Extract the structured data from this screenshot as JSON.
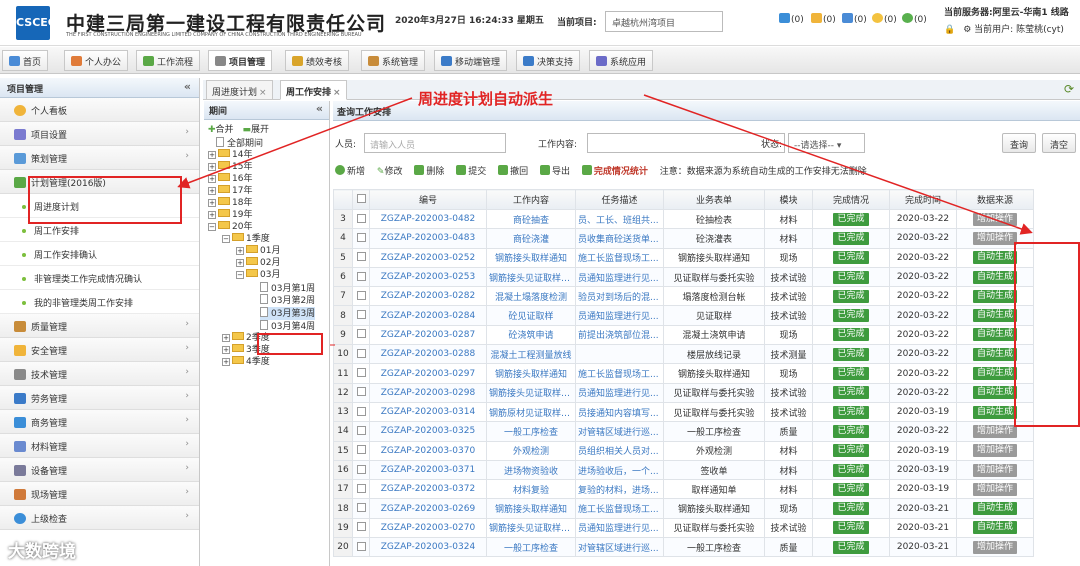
{
  "header": {
    "logo_text": "CSCEC",
    "company_name": "中建三局第一建设工程有限责任公司",
    "company_name_en": "THE FIRST CONSTRUCTION ENGINEERING LIMITED COMPANY OF CHINA CONSTRUCTION THIRD ENGINEERING BUREAU",
    "datetime": "2020年3月27日 16:24:33 星期五",
    "project_label": "当前项目:",
    "project_value": "卓越杭州湾项目",
    "notifications": [
      "(0)",
      "(0)",
      "(0)",
      "(0)",
      "(0)"
    ],
    "server": "当前服务器:阿里云-华南1 线路",
    "user": "当前用户: 陈莹桃(cyt)"
  },
  "nav": {
    "tabs": [
      "首页",
      "个人办公",
      "工作流程",
      "项目管理",
      "绩效考核",
      "系统管理",
      "移动端管理",
      "决策支持",
      "系统应用"
    ],
    "active": "项目管理"
  },
  "sidebar": {
    "title": "项目管理",
    "items": [
      {
        "label": "个人看板",
        "type": "item"
      },
      {
        "label": "项目设置",
        "type": "item"
      },
      {
        "label": "策划管理",
        "type": "item"
      },
      {
        "label": "计划管理(2016版)",
        "type": "item"
      },
      {
        "label": "周进度计划",
        "type": "sub"
      },
      {
        "label": "周工作安排",
        "type": "sub"
      },
      {
        "label": "周工作安排确认",
        "type": "sub"
      },
      {
        "label": "非管理类工作完成情况确认",
        "type": "sub"
      },
      {
        "label": "我的非管理类周工作安排",
        "type": "sub"
      },
      {
        "label": "质量管理",
        "type": "item"
      },
      {
        "label": "安全管理",
        "type": "item"
      },
      {
        "label": "技术管理",
        "type": "item"
      },
      {
        "label": "劳务管理",
        "type": "item"
      },
      {
        "label": "商务管理",
        "type": "item"
      },
      {
        "label": "材料管理",
        "type": "item"
      },
      {
        "label": "设备管理",
        "type": "item"
      },
      {
        "label": "现场管理",
        "type": "item"
      },
      {
        "label": "上级检查",
        "type": "item"
      }
    ]
  },
  "page_tabs": [
    {
      "label": "周进度计划",
      "active": false
    },
    {
      "label": "周工作安排",
      "active": true
    }
  ],
  "tree": {
    "title": "期间",
    "merge": "合并",
    "expand": "展开",
    "nodes": [
      "全部期间",
      "14年",
      "15年",
      "16年",
      "17年",
      "18年",
      "19年",
      "20年",
      "1季度",
      "01月",
      "02月",
      "03月",
      "03月第1周",
      "03月第2周",
      "03月第3周",
      "03月第4周",
      "2季度",
      "3季度",
      "4季度"
    ]
  },
  "query": {
    "title": "查询工作安排",
    "person_label": "人员:",
    "person_placeholder": "请输入人员",
    "content_label": "工作内容:",
    "content_value": "",
    "status_label": "状态:",
    "status_value": "--请选择--",
    "search_btn": "查询",
    "clear_btn": "清空"
  },
  "toolbar": {
    "add": "新增",
    "edit": "修改",
    "delete": "删除",
    "submit": "提交",
    "revoke": "撤回",
    "export": "导出",
    "stats": "完成情况统计",
    "note": "注意：数据来源为系统自动生成的工作安排无法删除"
  },
  "table": {
    "headers": [
      "",
      "编号",
      "工作内容",
      "任务描述",
      "业务表单",
      "模块",
      "完成情况",
      "完成时间",
      "数据来源"
    ],
    "rows": [
      {
        "no": "3",
        "code": "ZGZAP-202003-0482",
        "work": "商砼抽查",
        "desc": "员、工长、班组共...",
        "form": "砼抽检表",
        "module": "材料",
        "status": "已完成",
        "time": "2020-03-22",
        "source": "增加操作"
      },
      {
        "no": "4",
        "code": "ZGZAP-202003-0483",
        "work": "商砼浇灌",
        "desc": "员收集商砼送货单...",
        "form": "砼浇灌表",
        "module": "材料",
        "status": "已完成",
        "time": "2020-03-22",
        "source": "增加操作"
      },
      {
        "no": "5",
        "code": "ZGZAP-202003-0252",
        "work": "钢筋接头取样通知",
        "desc": "施工长监督现场工...",
        "form": "钢筋接头取样通知",
        "module": "现场",
        "status": "已完成",
        "time": "2020-03-22",
        "source": "自动生成"
      },
      {
        "no": "6",
        "code": "ZGZAP-202003-0253",
        "work": "钢筋接头见证取样送检",
        "desc": "员通知监理进行见...",
        "form": "见证取样与委托实验",
        "module": "技术试验",
        "status": "已完成",
        "time": "2020-03-22",
        "source": "自动生成"
      },
      {
        "no": "7",
        "code": "ZGZAP-202003-0282",
        "work": "混凝土塌落度检测",
        "desc": "验员对到场后的混...",
        "form": "塌落度检测台帐",
        "module": "技术试验",
        "status": "已完成",
        "time": "2020-03-22",
        "source": "自动生成"
      },
      {
        "no": "8",
        "code": "ZGZAP-202003-0284",
        "work": "砼见证取样",
        "desc": "员通知监理进行见...",
        "form": "见证取样",
        "module": "技术试验",
        "status": "已完成",
        "time": "2020-03-22",
        "source": "自动生成"
      },
      {
        "no": "9",
        "code": "ZGZAP-202003-0287",
        "work": "砼浇筑申请",
        "desc": "前提出浇筑部位混...",
        "form": "混凝土浇筑申请",
        "module": "现场",
        "status": "已完成",
        "time": "2020-03-22",
        "source": "自动生成"
      },
      {
        "no": "10",
        "code": "ZGZAP-202003-0288",
        "work": "混凝土工程测量放线",
        "desc": "",
        "form": "楼层放线记录",
        "module": "技术测量",
        "status": "已完成",
        "time": "2020-03-22",
        "source": "自动生成"
      },
      {
        "no": "11",
        "code": "ZGZAP-202003-0297",
        "work": "钢筋接头取样通知",
        "desc": "施工长监督现场工...",
        "form": "钢筋接头取样通知",
        "module": "现场",
        "status": "已完成",
        "time": "2020-03-22",
        "source": "自动生成"
      },
      {
        "no": "12",
        "code": "ZGZAP-202003-0298",
        "work": "钢筋接头见证取样送检",
        "desc": "员通知监理进行见...",
        "form": "见证取样与委托实验",
        "module": "技术试验",
        "status": "已完成",
        "time": "2020-03-22",
        "source": "自动生成"
      },
      {
        "no": "13",
        "code": "ZGZAP-202003-0314",
        "work": "钢筋原材见证取样送检",
        "desc": "员接通知内容填写...",
        "form": "见证取样与委托实验",
        "module": "技术试验",
        "status": "已完成",
        "time": "2020-03-19",
        "source": "自动生成"
      },
      {
        "no": "14",
        "code": "ZGZAP-202003-0325",
        "work": "一般工序检查",
        "desc": "对管辖区域进行巡...",
        "form": "一般工序检查",
        "module": "质量",
        "status": "已完成",
        "time": "2020-03-22",
        "source": "增加操作"
      },
      {
        "no": "15",
        "code": "ZGZAP-202003-0370",
        "work": "外观检测",
        "desc": "员组织相关人员对...",
        "form": "外观检测",
        "module": "材料",
        "status": "已完成",
        "time": "2020-03-19",
        "source": "增加操作"
      },
      {
        "no": "16",
        "code": "ZGZAP-202003-0371",
        "work": "进场物资验收",
        "desc": "进场验收后，一个...",
        "form": "签收单",
        "module": "材料",
        "status": "已完成",
        "time": "2020-03-19",
        "source": "增加操作"
      },
      {
        "no": "17",
        "code": "ZGZAP-202003-0372",
        "work": "材料复验",
        "desc": "复验的材料，进场...",
        "form": "取样通知单",
        "module": "材料",
        "status": "已完成",
        "time": "2020-03-19",
        "source": "增加操作"
      },
      {
        "no": "18",
        "code": "ZGZAP-202003-0269",
        "work": "钢筋接头取样通知",
        "desc": "施工长监督现场工...",
        "form": "钢筋接头取样通知",
        "module": "现场",
        "status": "已完成",
        "time": "2020-03-21",
        "source": "自动生成"
      },
      {
        "no": "19",
        "code": "ZGZAP-202003-0270",
        "work": "钢筋接头见证取样送检",
        "desc": "员通知监理进行见...",
        "form": "见证取样与委托实验",
        "module": "技术试验",
        "status": "已完成",
        "time": "2020-03-21",
        "source": "自动生成"
      },
      {
        "no": "20",
        "code": "ZGZAP-202003-0324",
        "work": "一般工序检查",
        "desc": "对管辖区域进行巡...",
        "form": "一般工序检查",
        "module": "质量",
        "status": "已完成",
        "time": "2020-03-21",
        "source": "增加操作"
      }
    ]
  },
  "annotation": "周进度计划自动派生",
  "watermark": "大数跨境",
  "colors": {
    "accent": "#e12424",
    "done": "#3e9b3e",
    "manual": "#9a9a9a",
    "link": "#3a78c2",
    "brand": "#1667b8"
  }
}
